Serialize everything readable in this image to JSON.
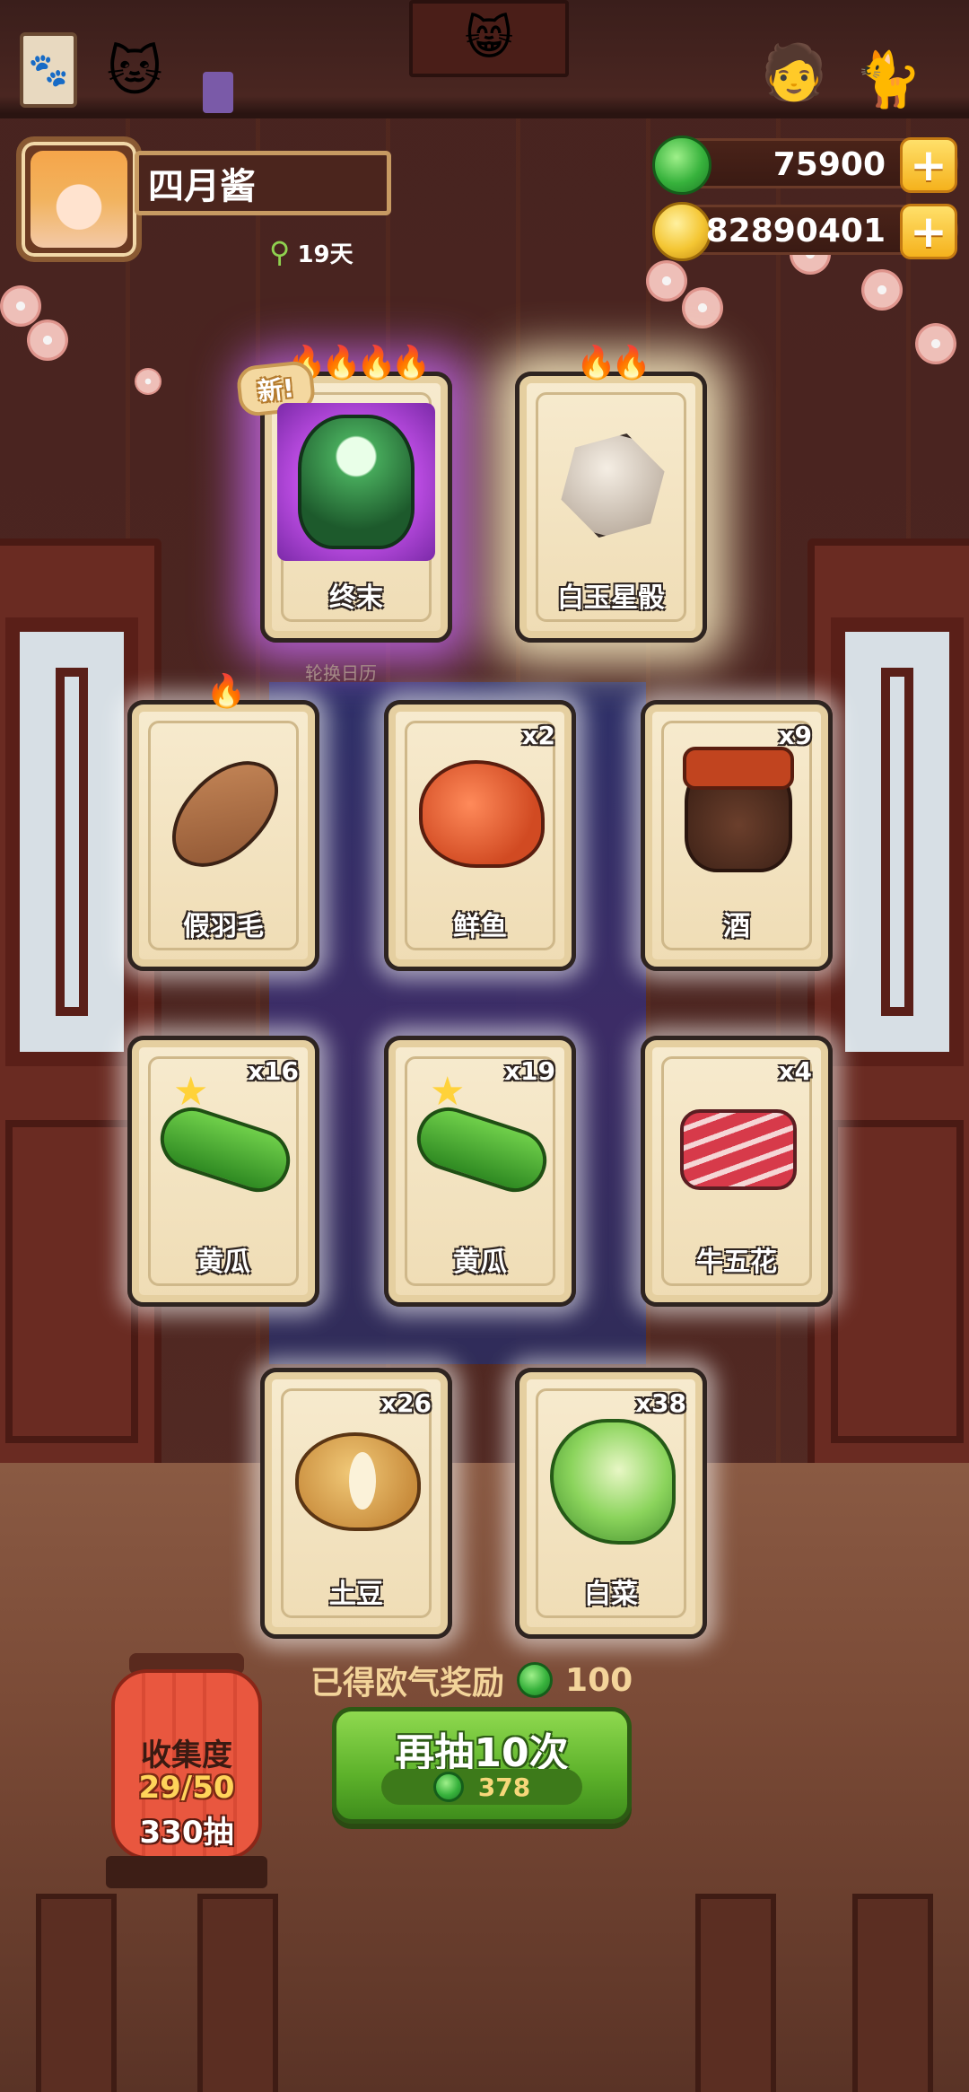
{
  "player": {
    "name": "四月酱",
    "days": "19天"
  },
  "currency": {
    "jade_amount": "75900",
    "coin_amount": "82890401",
    "plus_symbol": "+"
  },
  "banner_label": "轮换日历",
  "cards": [
    {
      "name": "终末",
      "quantity": "",
      "flames": "🔥🔥🔥🔥",
      "badge": "新!",
      "rarity": "purple"
    },
    {
      "name": "白玉星骰",
      "quantity": "",
      "flames": "🔥🔥",
      "badge": "",
      "rarity": "gold"
    },
    {
      "name": "假羽毛",
      "quantity": "",
      "flames": "🔥",
      "badge": "",
      "rarity": "normal"
    },
    {
      "name": "鲜鱼",
      "quantity": "x2",
      "flames": "",
      "badge": "",
      "rarity": "normal"
    },
    {
      "name": "酒",
      "quantity": "x9",
      "flames": "",
      "badge": "",
      "rarity": "normal"
    },
    {
      "name": "黄瓜",
      "quantity": "x16",
      "flames": "",
      "badge": "",
      "rarity": "normal"
    },
    {
      "name": "黄瓜",
      "quantity": "x19",
      "flames": "",
      "badge": "",
      "rarity": "normal"
    },
    {
      "name": "牛五花",
      "quantity": "x4",
      "flames": "",
      "badge": "",
      "rarity": "normal"
    },
    {
      "name": "土豆",
      "quantity": "x26",
      "flames": "",
      "badge": "",
      "rarity": "normal"
    },
    {
      "name": "白菜",
      "quantity": "x38",
      "flames": "",
      "badge": "",
      "rarity": "normal"
    }
  ],
  "reward": {
    "label": "已得欧气奖励",
    "value": "100"
  },
  "draw_button": {
    "label": "再抽10次",
    "cost": "378"
  },
  "collection": {
    "title": "收集度",
    "progress": "29/50",
    "draws": "330抽"
  },
  "icons": {
    "jade": "jade-currency-icon",
    "coin": "gold-coin-icon",
    "sprout": "sprout-icon"
  },
  "colors": {
    "accent_green": "#5cb12a",
    "accent_gold": "#f5b21d",
    "rare_glow": "#ce6eff"
  }
}
